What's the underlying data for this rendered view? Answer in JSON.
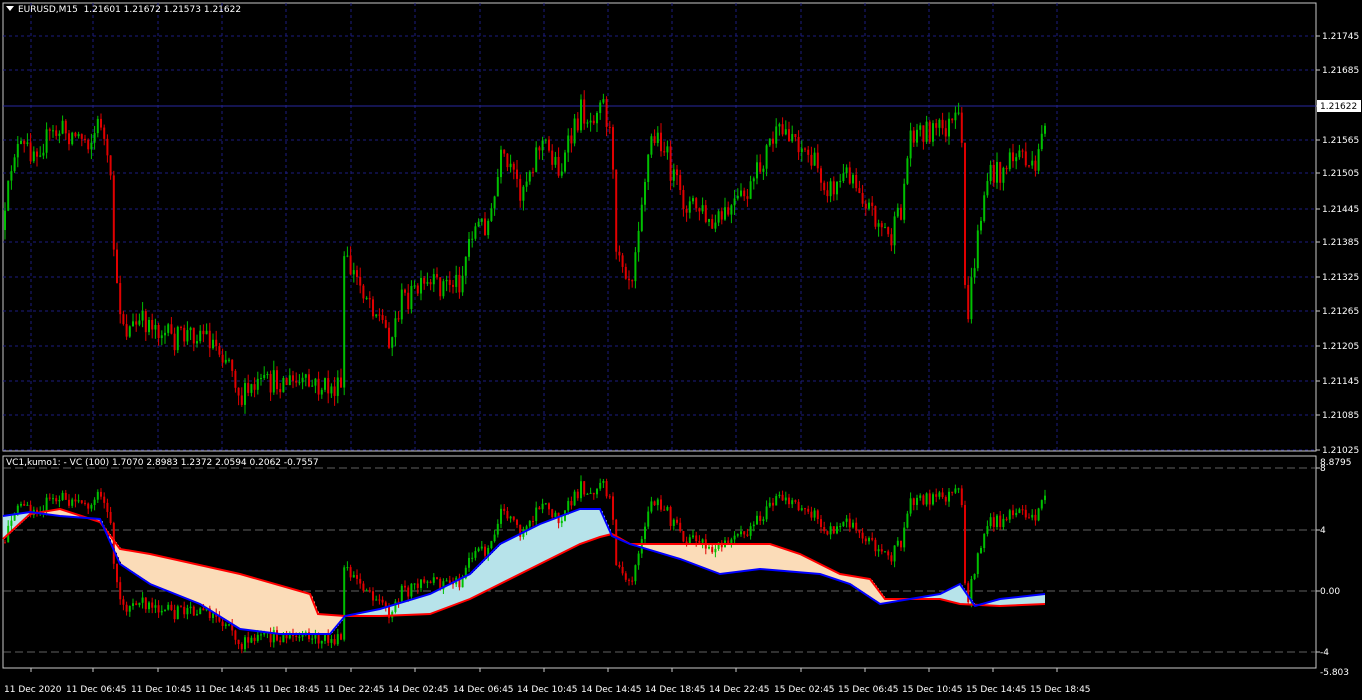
{
  "main": {
    "symbol": "EURUSD,M15",
    "ohlc": [
      "1.21601",
      "1.21672",
      "1.21573",
      "1.21622"
    ],
    "current_price": "1.21622",
    "price_labels": [
      "1.21745",
      "1.21685",
      "1.21622",
      "1.21565",
      "1.21505",
      "1.21445",
      "1.21385",
      "1.21325",
      "1.21265",
      "1.21205",
      "1.21145",
      "1.21085",
      "1.21025"
    ],
    "colors": {
      "bull": "#00c000",
      "bear": "#e00000",
      "grid": "#1c1c80",
      "price_line": "#2828a0"
    }
  },
  "indicator": {
    "title": "VC1,kumo1: - VC (100)",
    "values": [
      "1.7070",
      "2.8983",
      "1.2372",
      "2.0594",
      "0.2062",
      "-0.7557"
    ],
    "max_label": "8.8795",
    "min_label": "-5.803",
    "levels": [
      "8",
      "4",
      "0.00",
      "-4"
    ],
    "colors": {
      "kumo_up": "#b7e3ea",
      "kumo_down": "#fbdcb8",
      "line_red": "#ff0000",
      "line_blue": "#0000ff"
    }
  },
  "time_labels": [
    "11 Dec 2020",
    "11 Dec 06:45",
    "11 Dec 10:45",
    "11 Dec 14:45",
    "11 Dec 18:45",
    "11 Dec 22:45",
    "14 Dec 02:45",
    "14 Dec 06:45",
    "14 Dec 10:45",
    "14 Dec 14:45",
    "14 Dec 18:45",
    "14 Dec 22:45",
    "15 Dec 02:45",
    "15 Dec 06:45",
    "15 Dec 10:45",
    "15 Dec 14:45",
    "15 Dec 18:45"
  ]
}
